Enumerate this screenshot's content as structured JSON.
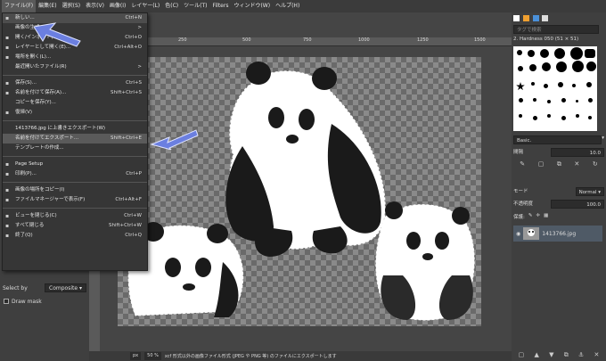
{
  "menubar": {
    "items": [
      "ファイル(F)",
      "編集(E)",
      "選択(S)",
      "表示(V)",
      "画像(I)",
      "レイヤー(L)",
      "色(C)",
      "ツール(T)",
      "Filters",
      "ウィンドウ(W)",
      "ヘルプ(H)"
    ]
  },
  "file_menu": {
    "items": [
      {
        "icon": "new-icon",
        "label": "新しい...",
        "shortcut": "Ctrl+N"
      },
      {
        "icon": "",
        "label": "画像の生成",
        "shortcut": ">"
      },
      {
        "icon": "open-icon",
        "label": "開く/インポート(O)...",
        "shortcut": "Ctrl+O"
      },
      {
        "icon": "open-as-layers-icon",
        "label": "レイヤーとして開く(E)...",
        "shortcut": "Ctrl+Alt+O"
      },
      {
        "icon": "open-location-icon",
        "label": "場所を開く(L)...",
        "shortcut": ""
      },
      {
        "icon": "",
        "label": "最近開いたファイル(R)",
        "shortcut": ">"
      },
      {
        "sep": true
      },
      {
        "icon": "save-icon",
        "label": "保存(S)...",
        "shortcut": "Ctrl+S"
      },
      {
        "icon": "save-as-icon",
        "label": "名前を付けて保存(A)...",
        "shortcut": "Shift+Ctrl+S"
      },
      {
        "icon": "",
        "label": "コピーを保存(Y)...",
        "shortcut": ""
      },
      {
        "icon": "revert-icon",
        "label": "復帰(V)",
        "shortcut": ""
      },
      {
        "sep": true
      },
      {
        "icon": "",
        "label": "1413766.jpg に上書きエクスポート(W)",
        "shortcut": ""
      },
      {
        "icon": "",
        "label": "名前を付けてエクスポート...",
        "shortcut": "Shift+Ctrl+E",
        "highlight": true
      },
      {
        "icon": "",
        "label": "テンプレートの作成...",
        "shortcut": ""
      },
      {
        "sep": true
      },
      {
        "icon": "page-setup-icon",
        "label": "Page Setup",
        "shortcut": ""
      },
      {
        "icon": "print-icon",
        "label": "印刷(P)...",
        "shortcut": "Ctrl+P"
      },
      {
        "sep": true
      },
      {
        "icon": "copy-location-icon",
        "label": "画像の場所をコピー(I)",
        "shortcut": ""
      },
      {
        "icon": "file-manager-icon",
        "label": "ファイルマネージャーで表示(F)",
        "shortcut": "Ctrl+Alt+F"
      },
      {
        "sep": true
      },
      {
        "icon": "close-view-icon",
        "label": "ビューを閉じる(C)",
        "shortcut": "Ctrl+W"
      },
      {
        "icon": "close-all-icon",
        "label": "すべて閉じる",
        "shortcut": "Shift+Ctrl+W"
      },
      {
        "icon": "quit-icon",
        "label": "終了(Q)",
        "shortcut": "Ctrl+Q"
      }
    ]
  },
  "left_panel": {
    "select_by_label": "Select by",
    "select_by_value": "Composite",
    "draw_mask_label": "Draw mask"
  },
  "ruler": {
    "ticks": [
      "250",
      "500",
      "750",
      "1000",
      "1250",
      "1500"
    ]
  },
  "status": {
    "unit": "px",
    "zoom": "50 %",
    "message": "xcf 形式以外の画像ファイル形式 (JPEG や PNG 等) のファイルにエクスポートします"
  },
  "right_panel": {
    "filter_placeholder": "タグで検索",
    "brush_name": "2. Hardness 050 (51 × 51)",
    "preset_label": "Basic.",
    "spacing_label": "間隔",
    "spacing_value": "10.0",
    "mode_label": "モード",
    "mode_value": "Normal",
    "opacity_label": "不透明度",
    "opacity_value": "100.0",
    "lock_label": "保護:",
    "layer_name": "1413766.jpg"
  },
  "colors": {
    "accent": "#4a90d9",
    "arrow": "#6b7fe0",
    "highlight": "#5a5a5a"
  }
}
